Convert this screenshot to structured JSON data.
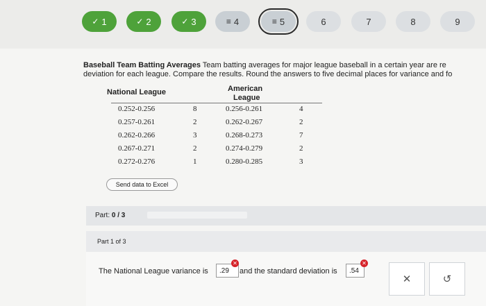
{
  "steps": [
    {
      "label": "1",
      "icon": "check-icon",
      "state": "done"
    },
    {
      "label": "2",
      "icon": "check-icon",
      "state": "done"
    },
    {
      "label": "3",
      "icon": "check-icon",
      "state": "done"
    },
    {
      "label": "4",
      "icon": "partial-icon",
      "state": "partial"
    },
    {
      "label": "5",
      "icon": "partial-icon",
      "state": "current"
    },
    {
      "label": "6",
      "icon": "",
      "state": "todo"
    },
    {
      "label": "7",
      "icon": "",
      "state": "todo"
    },
    {
      "label": "8",
      "icon": "",
      "state": "todo"
    },
    {
      "label": "9",
      "icon": "",
      "state": "todo"
    }
  ],
  "problem": {
    "title": "Baseball Team Batting Averages",
    "line1": " Team batting averages for major league baseball in a certain year are re",
    "line2": "deviation for each league. Compare the results. Round the answers to five decimal places for variance and fo"
  },
  "table": {
    "nl_header": "National League",
    "al_header_1": "American",
    "al_header_2": "League",
    "nl_rows": [
      {
        "range": "0.252-0.256",
        "count": "8"
      },
      {
        "range": "0.257-0.261",
        "count": "2"
      },
      {
        "range": "0.262-0.266",
        "count": "3"
      },
      {
        "range": "0.267-0.271",
        "count": "2"
      },
      {
        "range": "0.272-0.276",
        "count": "1"
      }
    ],
    "al_rows": [
      {
        "range": "0.256-0.261",
        "count": "4"
      },
      {
        "range": "0.262-0.267",
        "count": "2"
      },
      {
        "range": "0.268-0.273",
        "count": "7"
      },
      {
        "range": "0.274-0.279",
        "count": "2"
      },
      {
        "range": "0.280-0.285",
        "count": "3"
      }
    ]
  },
  "send_button": "Send data to Excel",
  "part": {
    "prefix": "Part: ",
    "value": "0 / 3",
    "progress_fraction": 0
  },
  "part1_label": "Part 1 of 3",
  "answer": {
    "text_before": "The National League variance is",
    "variance_value": ".29",
    "text_mid": "and the standard deviation is",
    "sd_value": ".54"
  },
  "actions": {
    "clear": "✕",
    "redo": "↺"
  },
  "colors": {
    "done": "#4ea23a",
    "error": "#d6232a"
  }
}
